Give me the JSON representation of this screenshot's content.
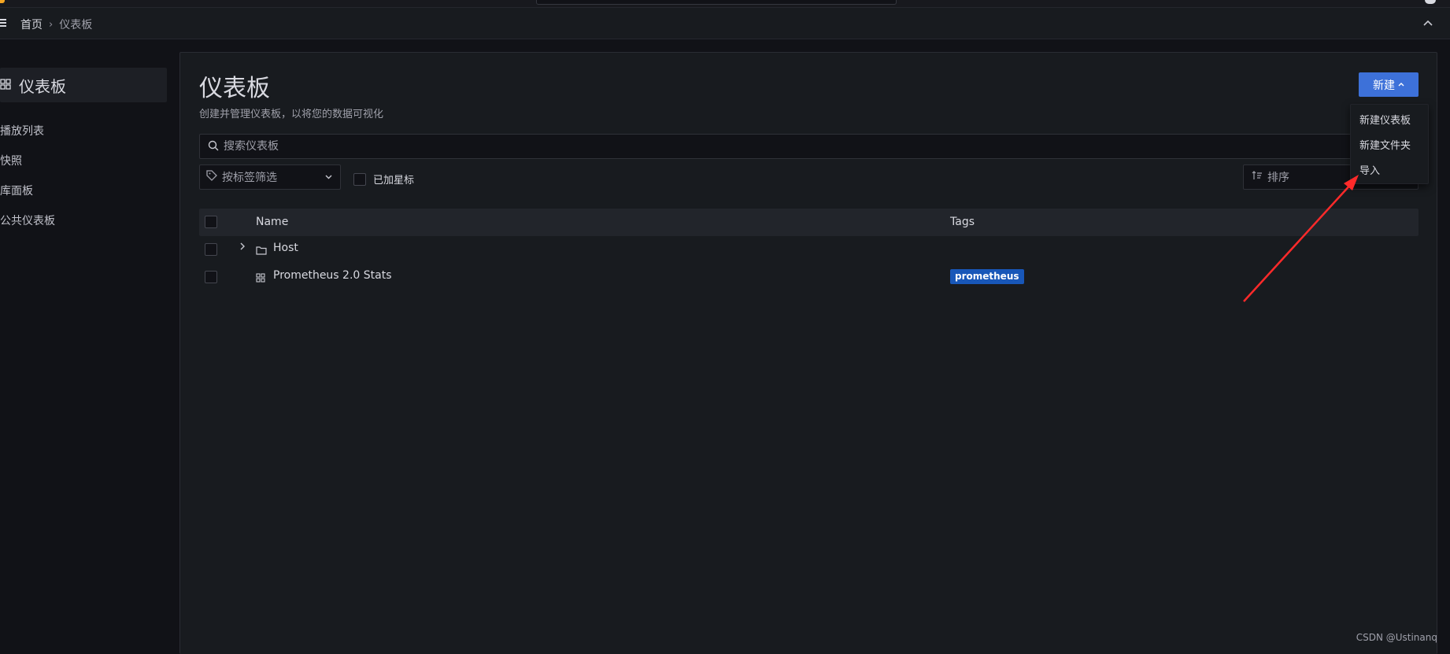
{
  "breadcrumb": {
    "home": "首页",
    "separator": "›",
    "current": "仪表板"
  },
  "sidebar": {
    "active_label": "仪表板",
    "items": [
      {
        "label": "播放列表"
      },
      {
        "label": "快照"
      },
      {
        "label": "库面板"
      },
      {
        "label": "公共仪表板"
      }
    ]
  },
  "page": {
    "title": "仪表板",
    "subtitle": "创建并管理仪表板，以将您的数据可视化",
    "new_button": "新建"
  },
  "search": {
    "placeholder": "搜索仪表板"
  },
  "filters": {
    "tag_filter_placeholder": "按标签筛选",
    "starred_label": "已加星标",
    "sort_placeholder": "排序"
  },
  "table": {
    "headers": {
      "name": "Name",
      "tags": "Tags"
    },
    "rows": [
      {
        "type": "folder",
        "name": "Host",
        "tags": []
      },
      {
        "type": "dashboard",
        "name": "Prometheus 2.0 Stats",
        "tags": [
          "prometheus"
        ]
      }
    ]
  },
  "new_menu": {
    "items": [
      {
        "label": "新建仪表板"
      },
      {
        "label": "新建文件夹"
      },
      {
        "label": "导入"
      }
    ]
  },
  "colors": {
    "accent": "#3d71d9",
    "tag_prometheus": "#1857b8",
    "annotation_arrow": "#ff2a2a"
  },
  "watermark": "CSDN @Ustinanq"
}
